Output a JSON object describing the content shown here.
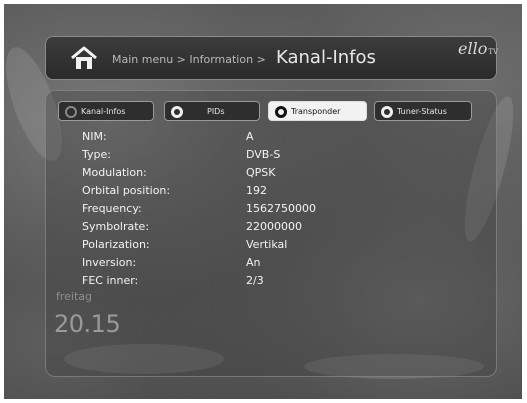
{
  "header": {
    "breadcrumb": "Main menu > Information >",
    "title": "Kanal-Infos",
    "logo": "ello",
    "logo_suffix": "TV"
  },
  "tabs": [
    {
      "label": "Kanal-Infos",
      "selected": false
    },
    {
      "label": "PIDs",
      "selected": false
    },
    {
      "label": "Transponder",
      "selected": true
    },
    {
      "label": "Tuner-Status",
      "selected": false
    }
  ],
  "info": [
    {
      "label": "NIM:",
      "value": "A"
    },
    {
      "label": "Type:",
      "value": "DVB-S"
    },
    {
      "label": "Modulation:",
      "value": "QPSK"
    },
    {
      "label": "Orbital position:",
      "value": "192"
    },
    {
      "label": "Frequency:",
      "value": "1562750000"
    },
    {
      "label": "Symbolrate:",
      "value": "22000000"
    },
    {
      "label": "Polarization:",
      "value": "Vertikal"
    },
    {
      "label": "Inversion:",
      "value": "An"
    },
    {
      "label": "FEC inner:",
      "value": "2/3"
    }
  ],
  "clock": {
    "day": "freitag",
    "time": "20.15"
  },
  "icons": {
    "home": "home-icon"
  }
}
